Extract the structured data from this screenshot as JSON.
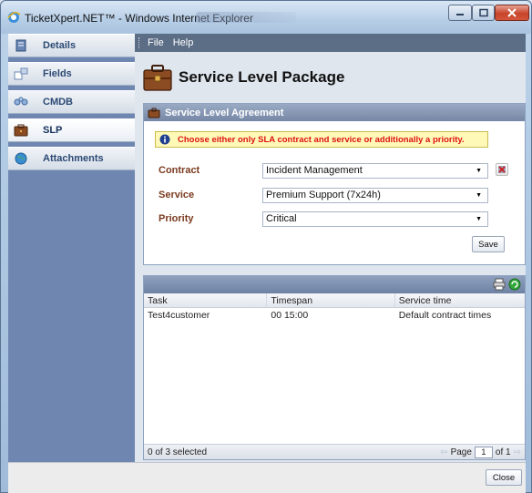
{
  "window": {
    "title": "TicketXpert.NET™ - Windows Internet Explorer",
    "icon": "ie-logo-icon",
    "controls": [
      "minimize-icon",
      "maximize-icon",
      "close-icon"
    ]
  },
  "menu": {
    "items": [
      "File",
      "Help"
    ]
  },
  "sidebar": {
    "items": [
      {
        "label": "Details",
        "icon": "details-icon",
        "active": false
      },
      {
        "label": "Fields",
        "icon": "fields-icon",
        "active": false
      },
      {
        "label": "CMDB",
        "icon": "cmdb-icon",
        "active": false
      },
      {
        "label": "SLP",
        "icon": "slp-icon",
        "active": true
      },
      {
        "label": "Attachments",
        "icon": "globe-icon",
        "active": false
      }
    ]
  },
  "page": {
    "title": "Service Level Package",
    "icon": "briefcase-icon"
  },
  "sla": {
    "header": "Service Level Agreement",
    "info": "Choose either only SLA contract and service or additionally a priority.",
    "contract": {
      "label": "Contract",
      "value": "Incident Management"
    },
    "service": {
      "label": "Service",
      "value": "Premium Support (7x24h)"
    },
    "priority": {
      "label": "Priority",
      "value": "Critical"
    },
    "save_label": "Save"
  },
  "tasks": {
    "columns": [
      "Task",
      "Timespan",
      "Service time"
    ],
    "rows": [
      {
        "task": "Test4customer",
        "timespan": "00 15:00",
        "service_time": "Default contract times"
      }
    ],
    "selection": "0 of 3 selected",
    "pager": {
      "page_label": "Page",
      "page": "1",
      "of_label": "of 1"
    }
  },
  "footer": {
    "close_label": "Close"
  },
  "colors": {
    "sidebar": "#6f87b0",
    "warning_text": "#dd1111",
    "info_bg": "#fff9b8",
    "menubar": "#5c6e86"
  }
}
